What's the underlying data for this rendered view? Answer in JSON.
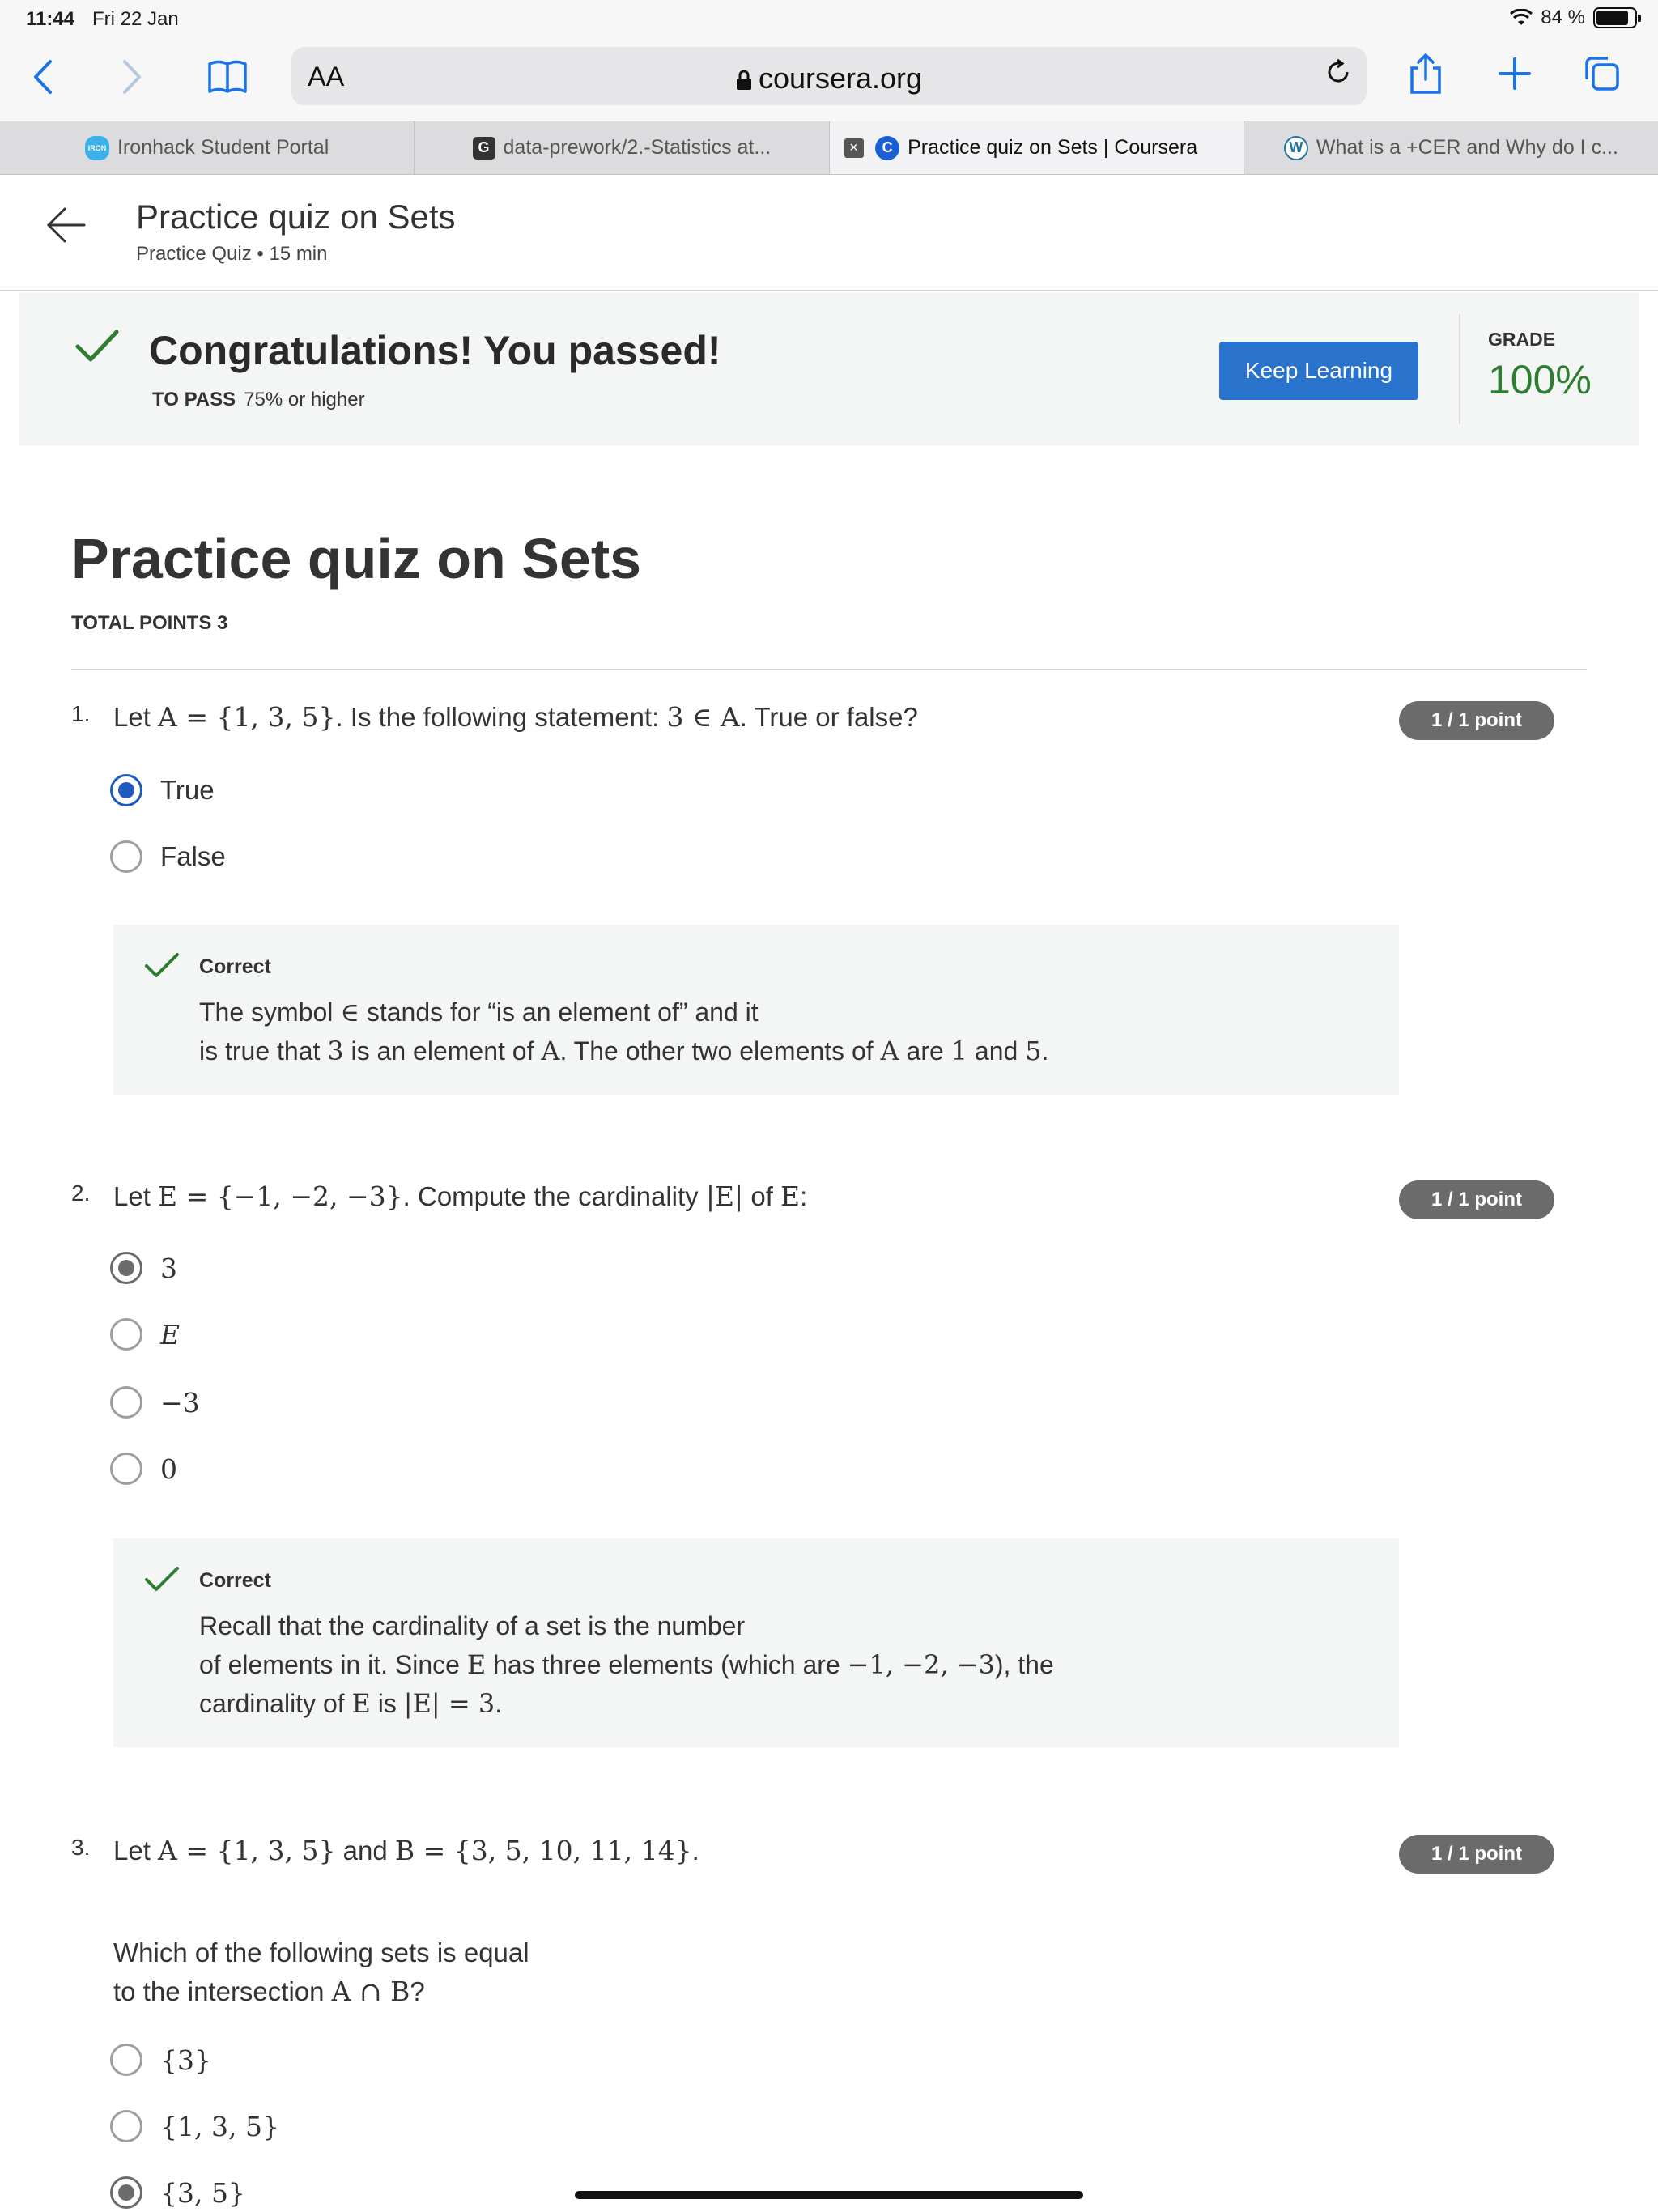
{
  "status_bar": {
    "time": "11:44",
    "date": "Fri 22 Jan",
    "battery": "84 %"
  },
  "toolbar": {
    "text_size": "AA",
    "url": "coursera.org"
  },
  "tabs": [
    {
      "label": "Ironhack Student Portal",
      "favicon": "IRON"
    },
    {
      "label": "data-prework/2.-Statistics at...",
      "favicon": "G"
    },
    {
      "label": "Practice quiz on Sets | Coursera",
      "favicon": "C"
    },
    {
      "label": "What is a +CER and Why do I c...",
      "favicon": "W"
    }
  ],
  "header": {
    "title": "Practice quiz on Sets",
    "subtitle": "Practice Quiz • 15 min"
  },
  "banner": {
    "message": "Congratulations! You passed!",
    "to_pass_label": "TO PASS",
    "to_pass_value": "75% or higher",
    "button": "Keep Learning",
    "grade_label": "GRADE",
    "grade_value": "100%"
  },
  "quiz": {
    "title": "Practice quiz on Sets",
    "total_points": "TOTAL POINTS 3"
  },
  "questions": [
    {
      "number": "1.",
      "parts": [
        "Let ",
        "A = {1, 3, 5}",
        ". Is the following statement:  ",
        "3 ∈ A",
        ".  True or false?"
      ],
      "points": "1 / 1 point",
      "options": [
        "True",
        "False"
      ],
      "selected": 0,
      "feedback_label": "Correct",
      "feedback": [
        [
          "The symbol ",
          "∈",
          " stands for “is an element of” and it"
        ],
        [
          "is true that ",
          "3",
          " is an element of ",
          "A",
          ". The other two elements of ",
          "A",
          " are ",
          "1",
          " and ",
          "5",
          "."
        ]
      ]
    },
    {
      "number": "2.",
      "parts": [
        "Let ",
        "E = {−1, −2, −3}",
        ". Compute the cardinality ",
        "|E|",
        " of ",
        "E",
        ":"
      ],
      "points": "1 / 1 point",
      "options": [
        "3",
        "E",
        "−3",
        "0"
      ],
      "selected": 0,
      "feedback_label": "Correct",
      "feedback": [
        [
          "Recall that the cardinality of a set is the number"
        ],
        [
          "of elements in it. Since ",
          "E",
          " has three elements (which are ",
          "−1, −2, −3",
          "), the"
        ],
        [
          "cardinality of ",
          "E",
          " is ",
          "|E| = 3",
          "."
        ]
      ]
    },
    {
      "number": "3.",
      "parts": [
        "Let ",
        "A = {1, 3, 5}",
        " and ",
        "B = {3, 5, 10, 11, 14}",
        "."
      ],
      "points": "1 / 1 point",
      "prompt": [
        [
          "Which of the following sets is equal"
        ],
        [
          "to the intersection ",
          "A ∩ B",
          "?"
        ]
      ],
      "options": [
        "{3}",
        "{1, 3, 5}",
        "{3, 5}"
      ],
      "selected": 2
    }
  ]
}
